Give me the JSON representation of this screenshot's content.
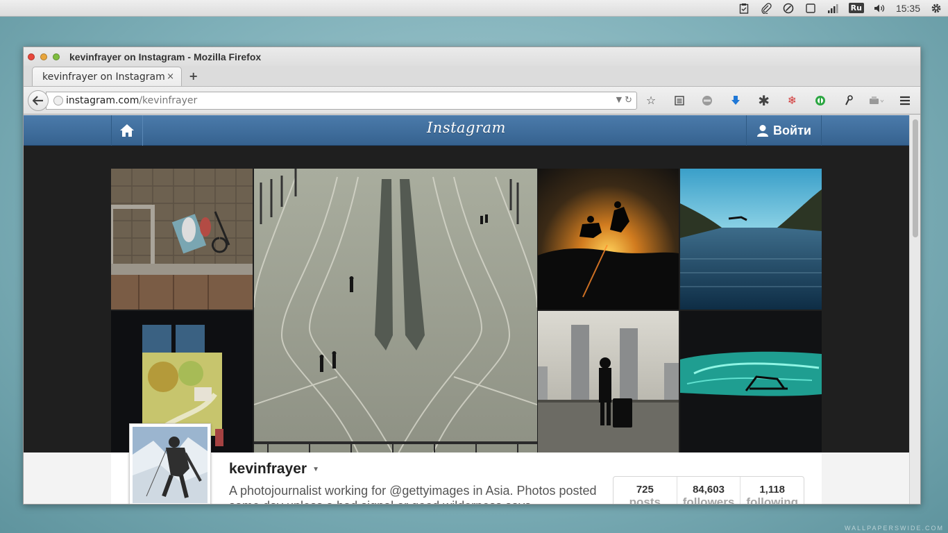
{
  "system_panel": {
    "language": "Ru",
    "time": "15:35",
    "icons": [
      "clipboard-icon",
      "paperclip-icon",
      "sync-icon",
      "window-icon",
      "signal-icon",
      "language-icon",
      "volume-icon",
      "gear-icon"
    ]
  },
  "window": {
    "title": "kevinfrayer on Instagram - Mozilla Firefox"
  },
  "tabs": [
    {
      "label": "kevinfrayer on Instagram",
      "close": "×"
    }
  ],
  "new_tab": "+",
  "url": {
    "domain": "instagram.com",
    "path": "/kevinfrayer"
  },
  "instagram": {
    "logo": "Instagram",
    "login_label": "Войти"
  },
  "profile": {
    "username": "kevinfrayer",
    "bio": "A photojournalist working for @gettyimages in Asia. Photos posted same day unless a bad signal or good wilderness says",
    "stats": [
      {
        "value": "725",
        "label": "posts"
      },
      {
        "value": "84,603",
        "label": "followers"
      },
      {
        "value": "1,118",
        "label": "following"
      }
    ]
  },
  "watermark": "WALLPAPERSWIDE.COM",
  "colors": {
    "ig_header": "#3f6e9d",
    "desktop": "#8bbac2"
  }
}
